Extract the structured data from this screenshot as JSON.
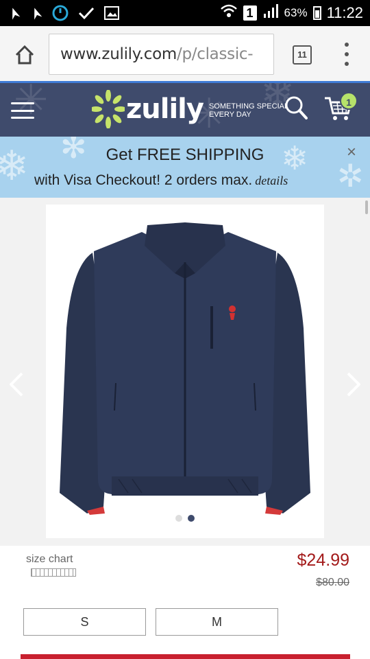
{
  "status_bar": {
    "time": "11:22",
    "battery": "63%",
    "sim": "1"
  },
  "browser": {
    "url_domain": "www.zulily.com",
    "url_path": "/p/classic-",
    "tab_count": "11"
  },
  "header": {
    "logo_text": "zulily",
    "tagline": "SOMETHING SPECIAL EVERY DAY",
    "cart_count": "1"
  },
  "promo": {
    "line1": "Get FREE SHIPPING",
    "line2": "with Visa Checkout! 2 orders max.",
    "details_link": "details",
    "close": "×"
  },
  "product": {
    "image_count": 2,
    "active_image_index": 1,
    "size_chart_label": "size chart",
    "price": "$24.99",
    "original_price": "$80.00",
    "sizes": [
      "S",
      "M"
    ]
  },
  "colors": {
    "header_bg": "#3f4b6c",
    "promo_bg": "#a8d2ee",
    "price_red": "#a31a1a",
    "cta_red": "#c8202f",
    "jacket_navy": "#2a3550",
    "badge_green": "#b6e26a"
  }
}
